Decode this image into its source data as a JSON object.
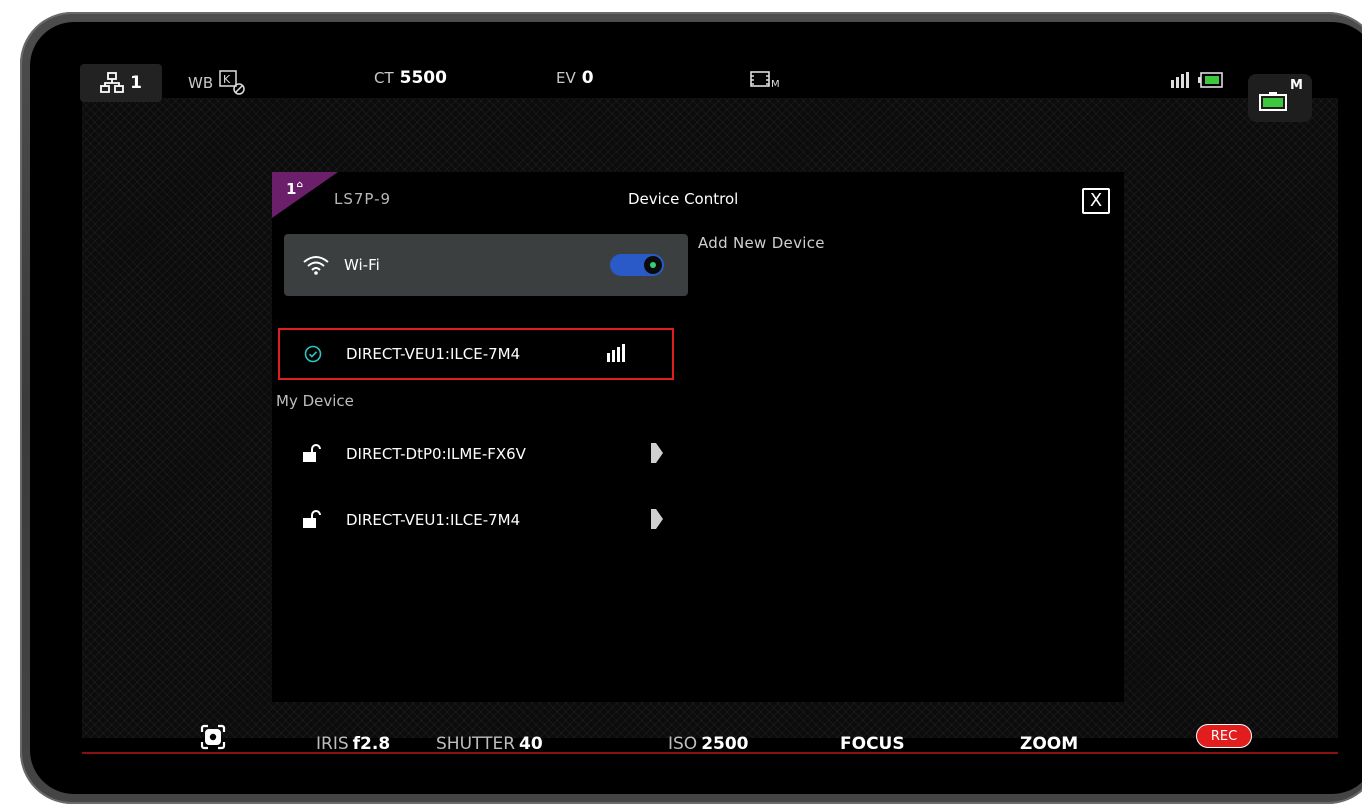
{
  "top_bar": {
    "network_count": "1",
    "wb_label": "WB",
    "ct_label": "CT",
    "ct_value": "5500",
    "ev_label": "EV",
    "ev_value": "0",
    "battery_mode": "M"
  },
  "dialog": {
    "badge_number": "1",
    "device_name": "LS7P-9",
    "title": "Device Control",
    "close_label": "X",
    "wifi_label": "Wi-Fi",
    "wifi_enabled": true,
    "add_new_label": "Add New Device",
    "connected_device": "DIRECT-VEU1:ILCE-7M4",
    "my_device_label": "My Device",
    "my_devices": [
      {
        "name": "DIRECT-DtP0:ILME-FX6V"
      },
      {
        "name": "DIRECT-VEU1:ILCE-7M4"
      }
    ]
  },
  "bottom_bar": {
    "iris_label": "IRIS",
    "iris_value": "f2.8",
    "shutter_label": "SHUTTER",
    "shutter_value": "40",
    "iso_label": "ISO",
    "iso_value": "2500",
    "focus_label": "FOCUS",
    "zoom_label": "ZOOM",
    "rec_label": "REC"
  },
  "colors": {
    "accent_blue": "#2a59c8",
    "highlight_red": "#e01e1e",
    "badge_purple": "#6b1f6b",
    "check_teal": "#2fc4c4",
    "battery_green": "#3ec83e"
  },
  "icons": [
    "network-icon",
    "wb-kelvin-icon",
    "film-icon",
    "signal-icon",
    "battery-icon",
    "wifi-icon",
    "check-icon",
    "lock-open-icon",
    "arrow-right-icon",
    "screenshot-icon"
  ]
}
